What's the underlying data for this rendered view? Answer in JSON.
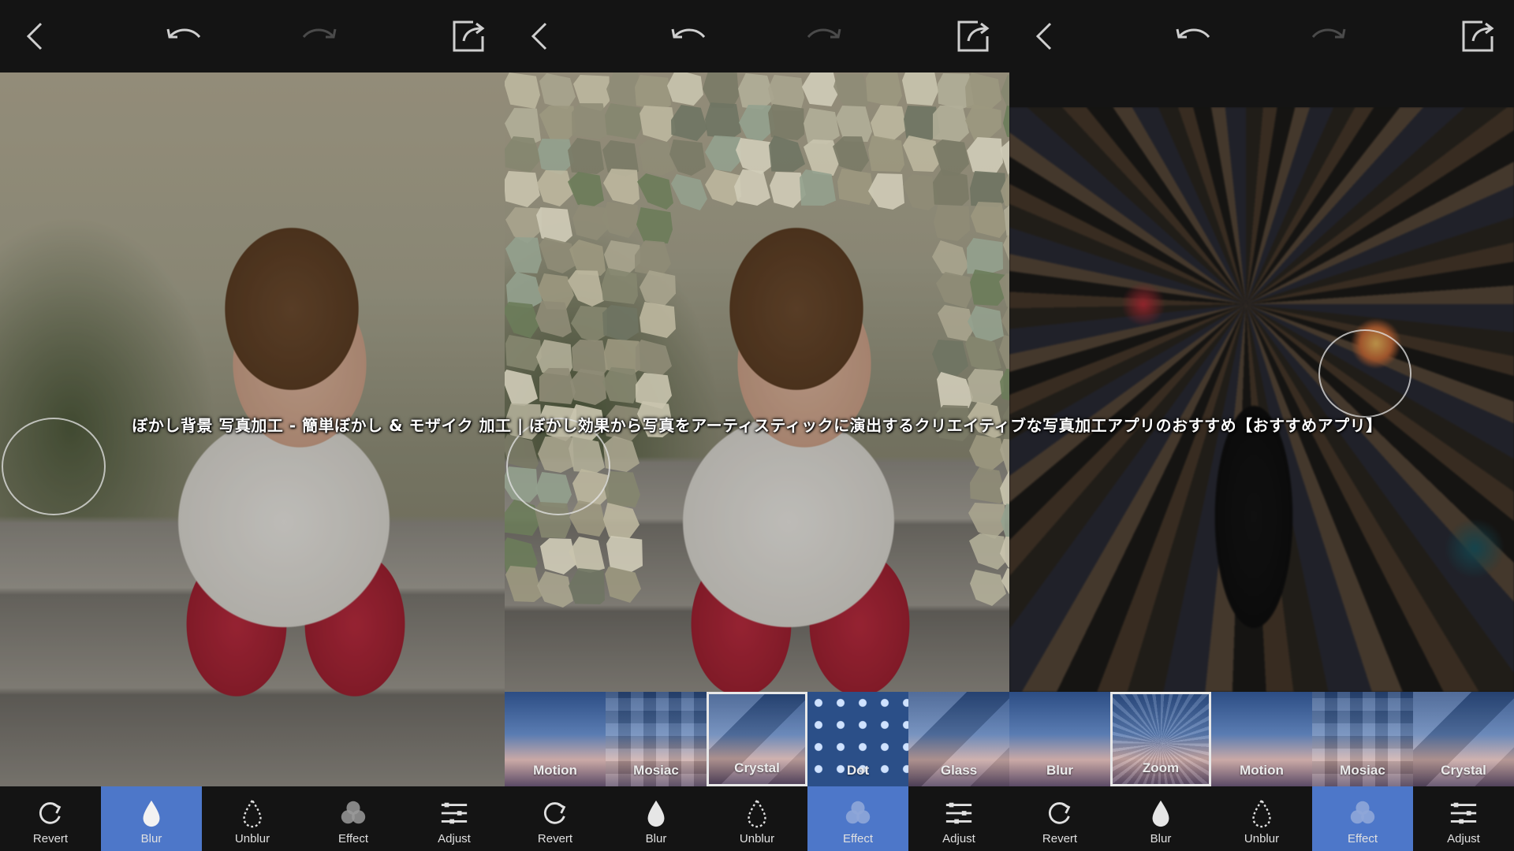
{
  "caption": "ぼかし背景 写真加工 - 簡単ぼかし & モザイク 加工 | ぼかし効果から写真をアーティスティックに演出するクリエイティブな写真加工アプリのおすすめ【おすすめアプリ】",
  "colors": {
    "background": "#141414",
    "accent": "#4d77c9",
    "icon": "#cfcfcf",
    "icon_disabled": "#4a4a4a"
  },
  "topbar_icons": [
    "back-arrow-icon",
    "undo-icon",
    "redo-icon",
    "share-icon"
  ],
  "screens": [
    {
      "photo": "girl sitting on steps, blurred background",
      "active_tool": "Blur",
      "tools": [
        "Revert",
        "Blur",
        "Unblur",
        "Effect",
        "Adjust"
      ],
      "effects": []
    },
    {
      "photo": "girl sitting on steps, crystal mosaic background",
      "active_tool": "Effect",
      "tools": [
        "Revert",
        "Blur",
        "Unblur",
        "Effect",
        "Adjust"
      ],
      "effects": [
        "Motion",
        "Mosiac",
        "Crystal",
        "Dot",
        "Glass"
      ],
      "selected_effect": "Crystal"
    },
    {
      "photo": "man walking in street, zoom blur",
      "active_tool": "Effect",
      "tools": [
        "Revert",
        "Blur",
        "Unblur",
        "Effect",
        "Adjust"
      ],
      "effects": [
        "Blur",
        "Zoom",
        "Motion",
        "Mosiac",
        "Crystal"
      ],
      "selected_effect": "Zoom"
    }
  ]
}
